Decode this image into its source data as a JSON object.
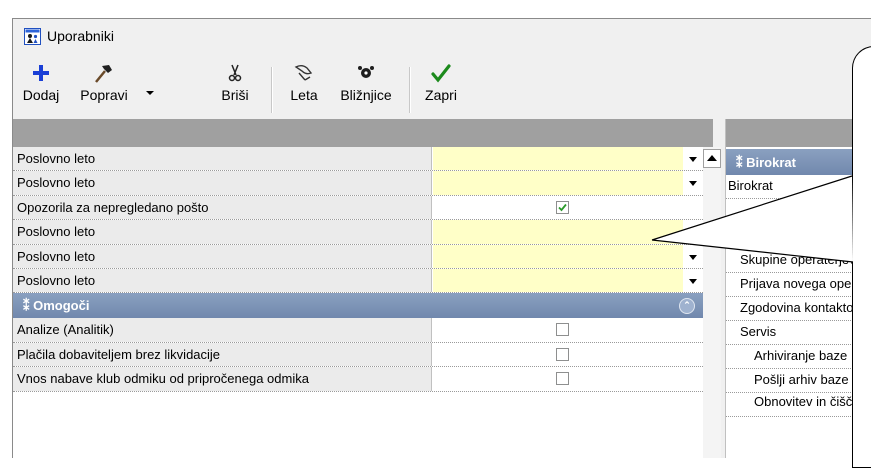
{
  "window": {
    "title": "Uporabniki"
  },
  "toolbar": {
    "add_label": "Dodaj",
    "edit_label": "Popravi",
    "delete_label": "Briši",
    "years_label": "Leta",
    "shortcuts_label": "Bližnjice",
    "close_label": "Zapri"
  },
  "properties": {
    "rows": [
      {
        "label": "Poslovno leto"
      },
      {
        "label": "Poslovno leto"
      },
      {
        "label": "Opozorila za nepregledano pošto"
      },
      {
        "label": "Poslovno leto"
      },
      {
        "label": "Poslovno leto"
      },
      {
        "label": "Poslovno leto"
      }
    ],
    "group": {
      "label": "Omogoči"
    },
    "group_rows": [
      {
        "label": "Analize (Analitik)"
      },
      {
        "label": "Plačila dobaviteljem brez likvidacije"
      },
      {
        "label": "Vnos nabave klub odmiku od pripročenega odmika"
      }
    ],
    "mail_warning_checked": true
  },
  "tree": {
    "group": {
      "label": "Birokrat"
    },
    "items": [
      {
        "label": "Birokrat"
      },
      {
        "label": "Skupine operaterjev"
      },
      {
        "label": "Prijava novega operaterja"
      },
      {
        "label": "Zgodovina kontaktov"
      },
      {
        "label": "Servis"
      },
      {
        "label": "Arhiviranje baze"
      },
      {
        "label": "Pošlji arhiv baze"
      },
      {
        "label": "Obnovitev in čiščenje"
      }
    ]
  },
  "colors": {
    "group_header": "#7f95b8",
    "yellow_field": "#ffffc8",
    "check_green": "#2a9a2a"
  }
}
